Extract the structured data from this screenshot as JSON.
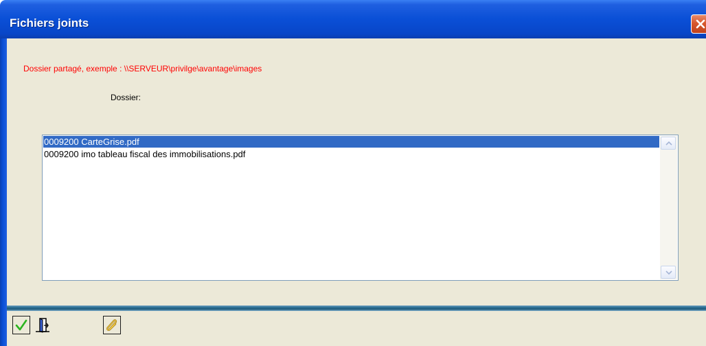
{
  "window": {
    "title": "Fichiers joints"
  },
  "form": {
    "hint": "Dossier partagé, exemple : \\\\SERVEUR\\privilge\\avantage\\images",
    "dossier_label": "Dossier:"
  },
  "files": [
    {
      "name": "0009200 CarteGrise.pdf",
      "selected": true
    },
    {
      "name": "0009200 imo tableau fiscal des immobilisations.pdf",
      "selected": false
    }
  ],
  "toolbar": {
    "buttons": [
      {
        "icon": "checkmark-icon"
      },
      {
        "icon": "exit-door-icon"
      },
      {
        "icon": "paperclip-icon"
      }
    ]
  },
  "colors": {
    "titlebar": "#0a4fd6",
    "hint": "#ff0000",
    "selection": "#316ac5",
    "client_background": "#ece9d8"
  }
}
